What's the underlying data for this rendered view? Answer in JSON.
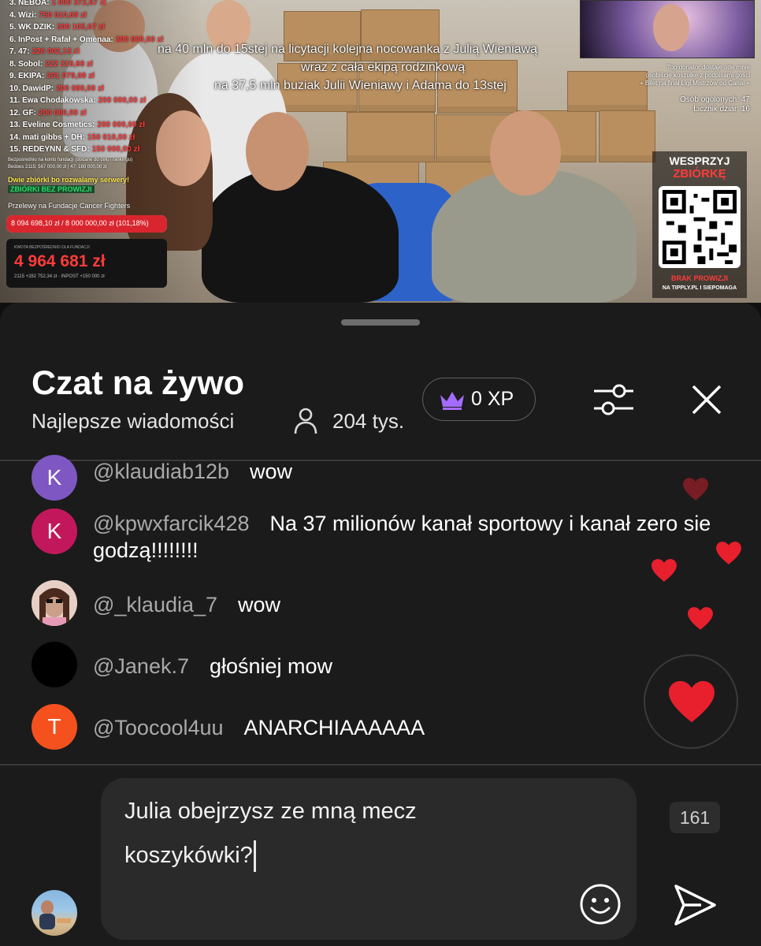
{
  "video": {
    "leaderboard": [
      {
        "label": "3. NEBOA:",
        "amount": "1 000 372,67 zł"
      },
      {
        "label": "4. Wizi:",
        "amount": "750 010,69 zł"
      },
      {
        "label": "5. WK DZIK:",
        "amount": "300 105,67 zł"
      },
      {
        "label": "6. InPost + Rafał + Omenaa:",
        "amount": "300 000,00 zł"
      },
      {
        "label": "7. 47:",
        "amount": "226 002,13 zł"
      },
      {
        "label": "8. Sobol:",
        "amount": "222 318,69 zł"
      },
      {
        "label": "9. EKIPA:",
        "amount": "201 079,00 zł"
      },
      {
        "label": "10. DawidP:",
        "amount": "200 080,00 zł"
      },
      {
        "label": "11. Ewa Chodakowska:",
        "amount": "200 000,00 zł"
      },
      {
        "label": "12. GF:",
        "amount": "200 000,00 zł"
      },
      {
        "label": "13. Eveline Cosmetics:",
        "amount": "200 000,00 zł"
      },
      {
        "label": "14. mati gibbs + DH:",
        "amount": "150 010,00 zł"
      },
      {
        "label": "15. REDEYNN & SFD:",
        "amount": "150 000,00 zł"
      }
    ],
    "direct_note": "Bezpośrednio na konto fundacji (dodane do celu i rankingu)",
    "direct_note2": "Bedoes 2115: 567 000,00 zł | 47: 180 000,00 zł",
    "promo1": "Dwie zbiórki bo rozwalamy serwery!",
    "promo2": "ZBIÓRKI BEZ PROWIZJI",
    "promo3": "Przelewy na Fundacje Cancer Fighters",
    "progress": {
      "text": "8 094 698,10 zł / 8 000 000,00 zł (101,18%)",
      "fraction": 1.0
    },
    "fund": {
      "label": "KWOTA BEZPOŚREDNIO DLA FUNDACJI",
      "value": "4 964 681 zł",
      "sub": "2115 +282 752,34 zł · INPOST +150 000 zł"
    },
    "headlines": [
      "na 40 mln do 15stej na licytacji kolejna nocowanka z Julią Wieniawą",
      "wraz z cała ekipą rodzinkową",
      "na 37,5 mln buziak Julii Wieniawy i Adama do 13stej"
    ],
    "info_lines": [
      "Top donator dostaje ode mnie",
      "osobiście koszulke z podpisami gości",
      "+ Bilet na finał Ligi Mistrzów od Canal +",
      "Osób ogolonych: 47",
      "Licznik dziar: 16"
    ],
    "support": {
      "line1": "WESPRZYJ",
      "line2": "ZBIÓRKĘ",
      "line3": "BRAK PROWIZJI",
      "line4": "NA TIPPLY.PL I SIEPOMAGA"
    }
  },
  "chat": {
    "title": "Czat na żywo",
    "subtitle": "Najlepsze wiadomości",
    "viewers": "204 tys.",
    "xp": "0 XP",
    "messages": [
      {
        "initial": "K",
        "author": "@klaudiab12b",
        "text": "wow",
        "avatar_color": "#7e57c2"
      },
      {
        "initial": "K",
        "author": "@kpwxfarcik428",
        "text": "Na 37 milionów kanał sportowy i kanał zero sie godzą!!!!!!!!",
        "avatar_color": "#c2185b"
      },
      {
        "initial": "",
        "author": "@_klaudia_7",
        "text": "wow",
        "avatar_color": "#d8b7a8"
      },
      {
        "initial": "",
        "author": "@Janek.7",
        "text": "głośniej mow",
        "avatar_color": "#000000"
      },
      {
        "initial": "T",
        "author": "@Toocool4uu",
        "text": "ANARCHIAAAAAA",
        "avatar_color": "#f4511e"
      }
    ],
    "input_value": "Julia obejrzysz ze mną mecz koszykówki?",
    "char_counter": "161",
    "accent_heart": "#e8202e"
  }
}
